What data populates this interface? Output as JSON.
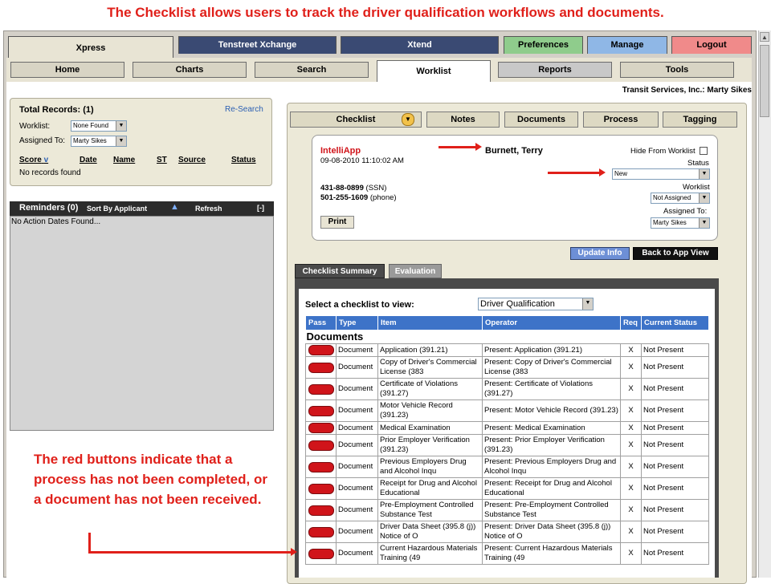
{
  "caption": "The Checklist allows users to track the driver qualification workflows and documents.",
  "top_tabs": [
    "Xpress",
    "Tenstreet Xchange",
    "Xtend",
    "Preferences",
    "Manage",
    "Logout"
  ],
  "nav_tabs": [
    "Home",
    "Charts",
    "Search",
    "Worklist",
    "Reports",
    "Tools"
  ],
  "company": "Transit Services, Inc.: Marty Sikes",
  "records": {
    "title": "Total Records: (1)",
    "research": "Re-Search",
    "worklist_label": "Worklist:",
    "worklist_value": "None Found",
    "assigned_label": "Assigned To:",
    "assigned_value": "Marty Sikes",
    "columns": [
      "Score",
      "Date",
      "Name",
      "ST",
      "Source",
      "Status"
    ],
    "empty": "No records found"
  },
  "reminders": {
    "title": "Reminders (0)",
    "sort": "Sort By Applicant",
    "refresh": "Refresh",
    "collapse": "[-]",
    "empty": "No Action Dates Found..."
  },
  "content_tabs": [
    "Checklist",
    "Notes",
    "Documents",
    "Process",
    "Tagging"
  ],
  "applicant": {
    "source": "IntelliApp",
    "datetime": "09-08-2010 11:10:02 AM",
    "name": "Burnett, Terry",
    "ssn": "431-88-0899",
    "ssn_label": "(SSN)",
    "phone": "501-255-1609",
    "phone_label": "(phone)",
    "print": "Print",
    "hide_label": "Hide From Worklist",
    "status_label": "Status",
    "status_value": "New",
    "worklist_label": "Worklist",
    "worklist_value": "Not Assigned",
    "assigned_label": "Assigned To:",
    "assigned_value": "Marty Sikes"
  },
  "buttons": {
    "update": "Update Info",
    "back": "Back to App View"
  },
  "sub_tabs": [
    "Checklist Summary",
    "Evaluation"
  ],
  "checklist": {
    "select_label": "Select a checklist to view:",
    "select_value": "Driver Qualification",
    "columns": [
      "Pass",
      "Type",
      "Item",
      "Operator",
      "Req",
      "Current Status"
    ],
    "section": "Documents",
    "rows": [
      {
        "type": "Document",
        "item": "Application (391.21)",
        "operator": "Present: Application (391.21)",
        "req": "X",
        "status": "Not Present"
      },
      {
        "type": "Document",
        "item": "Copy of Driver's Commercial License (383",
        "operator": "Present: Copy of Driver's Commercial License (383",
        "req": "X",
        "status": "Not Present"
      },
      {
        "type": "Document",
        "item": "Certificate of Violations (391.27)",
        "operator": "Present: Certificate of Violations (391.27)",
        "req": "X",
        "status": "Not Present"
      },
      {
        "type": "Document",
        "item": "Motor Vehicle Record (391.23)",
        "operator": "Present: Motor Vehicle Record (391.23)",
        "req": "X",
        "status": "Not Present"
      },
      {
        "type": "Document",
        "item": "Medical Examination",
        "operator": "Present: Medical Examination",
        "req": "X",
        "status": "Not Present"
      },
      {
        "type": "Document",
        "item": "Prior Employer Verification (391.23)",
        "operator": "Present: Prior Employer Verification (391.23)",
        "req": "X",
        "status": "Not Present"
      },
      {
        "type": "Document",
        "item": "Previous Employers Drug and Alcohol Inqu",
        "operator": "Present: Previous Employers Drug and Alcohol Inqu",
        "req": "X",
        "status": "Not Present"
      },
      {
        "type": "Document",
        "item": "Receipt for Drug and Alcohol Educational",
        "operator": "Present: Receipt for Drug and Alcohol Educational",
        "req": "X",
        "status": "Not Present"
      },
      {
        "type": "Document",
        "item": "Pre-Employment Controlled Substance Test",
        "operator": "Present: Pre-Employment Controlled Substance Test",
        "req": "X",
        "status": "Not Present"
      },
      {
        "type": "Document",
        "item": "Driver Data Sheet (395.8 (j)) Notice of O",
        "operator": "Present: Driver Data Sheet (395.8 (j)) Notice of O",
        "req": "X",
        "status": "Not Present"
      },
      {
        "type": "Document",
        "item": "Current Hazardous Materials Training (49",
        "operator": "Present: Current Hazardous Materials Training (49",
        "req": "X",
        "status": "Not Present"
      }
    ]
  },
  "annotation": "The red buttons indicate that a process has not been completed, or a document has not been received.",
  "colors": {
    "accent_red": "#e0201a",
    "header_blue": "#3d73c8",
    "pass_red": "#d0141a"
  },
  "icons": [
    "sort-down-icon",
    "up-arrow-icon",
    "dropdown-arrow-icon",
    "checkbox-icon"
  ]
}
